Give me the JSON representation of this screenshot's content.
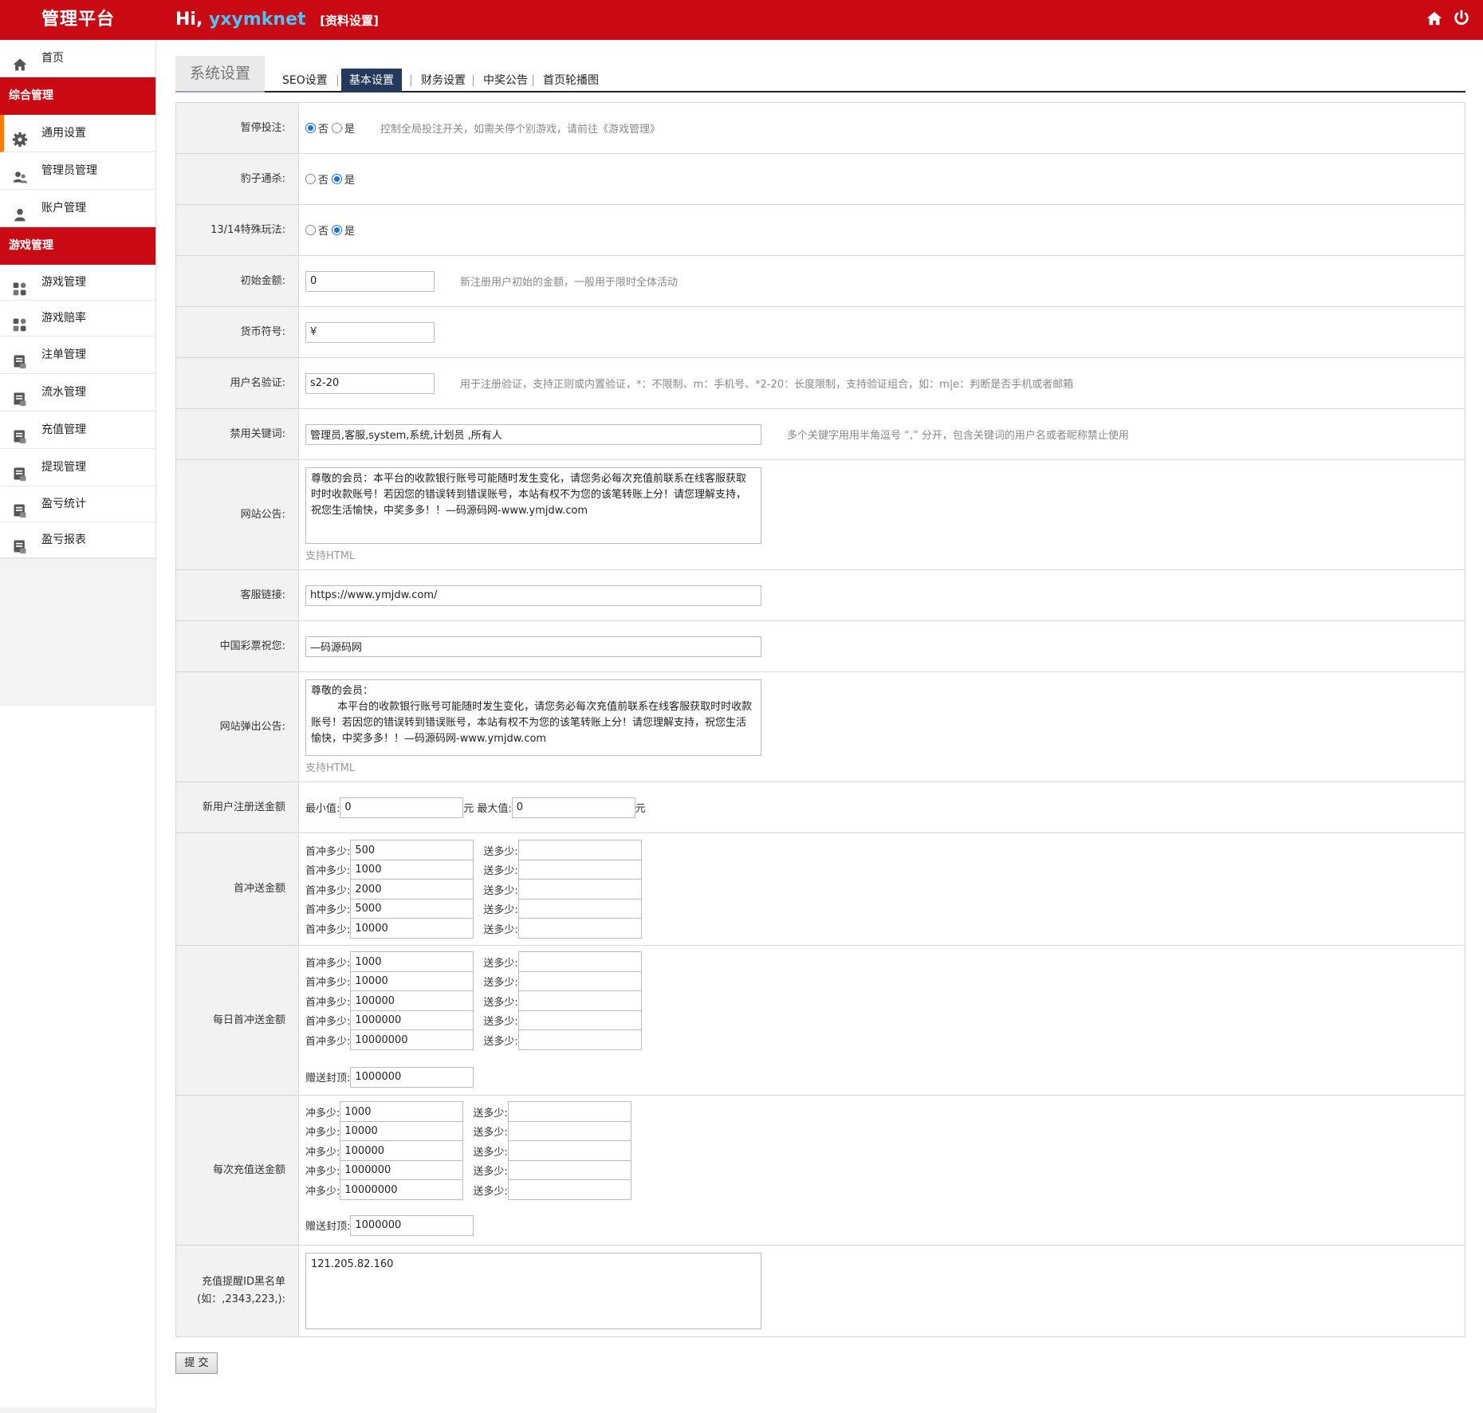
{
  "header": {
    "brand": "管理平台",
    "greeting": "Hi,",
    "username": "yxymknet",
    "profile_link": "[资料设置]"
  },
  "sidebar": {
    "home": "首页",
    "group1": "综合管理",
    "group1_items": [
      "通用设置",
      "管理员管理",
      "账户管理"
    ],
    "group2": "游戏管理",
    "group2_items": [
      "游戏管理",
      "游戏赔率",
      "注单管理",
      "流水管理",
      "充值管理",
      "提现管理",
      "盈亏统计",
      "盈亏报表"
    ]
  },
  "tabs": {
    "title": "系统设置",
    "items": [
      "SEO设置",
      "基本设置",
      "财务设置",
      "中奖公告",
      "首页轮播图"
    ],
    "active": "基本设置"
  },
  "form": {
    "pause_bet": {
      "label": "暂停投注:",
      "no": "否",
      "yes": "是",
      "selected": "否",
      "hint": "控制全局投注开关，如需关停个别游戏，请前往《游戏管理》"
    },
    "leopard": {
      "label": "豹子通杀:",
      "no": "否",
      "yes": "是",
      "selected": "是"
    },
    "special_1314": {
      "label": "13/14特殊玩法:",
      "no": "否",
      "yes": "是",
      "selected": "是"
    },
    "initial_amount": {
      "label": "初始金额:",
      "value": "0",
      "hint": "新注册用户初始的金额，一般用于限时全体活动"
    },
    "currency": {
      "label": "货币符号:",
      "value": "¥"
    },
    "username_check": {
      "label": "用户名验证:",
      "value": "s2-20",
      "hint": "用于注册验证，支持正则或内置验证，*：不限制、m：手机号、*2-20：长度限制，支持验证组合，如：m|e：判断是否手机或者邮箱"
    },
    "banned_words": {
      "label": "禁用关键词:",
      "value": "管理员,客服,system,系统,计划员 ,所有人",
      "hint": "多个关键字用用半角逗号 “,” 分开，包含关键词的用户名或者昵称禁止使用"
    },
    "site_notice": {
      "label": "网站公告:",
      "value": "尊敬的会员：本平台的收款银行账号可能随时发生变化，请您务必每次充值前联系在线客服获取时时收款账号！若因您的错误转到错误账号，本站有权不为您的该笔转账上分！请您理解支持，祝您生活愉快，中奖多多！！—码源码网-www.ymjdw.com",
      "note": "支持HTML"
    },
    "service_link": {
      "label": "客服链接:",
      "value": "https://www.ymjdw.com/"
    },
    "lottery_wish": {
      "label": "中国彩票祝您:",
      "value": "—码源码网"
    },
    "popup_notice": {
      "label": "网站弹出公告:",
      "value": "尊敬的会员：\n        本平台的收款银行账号可能随时发生变化，请您务必每次充值前联系在线客服获取时时收款账号！若因您的错误转到错误账号，本站有权不为您的该笔转账上分！请您理解支持，祝您生活愉快，中奖多多！！—码源码网-www.ymjdw.com",
      "note": "支持HTML"
    },
    "new_user_bonus": {
      "label": "新用户注册送金额",
      "min_label": "最小值:",
      "min": "0",
      "unit": "元",
      "max_label": "最大值:",
      "max": "0"
    },
    "first_deposit": {
      "label": "首冲送金额",
      "amount_label": "首冲多少:",
      "bonus_label": "送多少:",
      "amounts": [
        "500",
        "1000",
        "2000",
        "5000",
        "10000"
      ]
    },
    "daily_first": {
      "label": "每日首冲送金额",
      "amount_label": "首冲多少:",
      "bonus_label": "送多少:",
      "amounts": [
        "1000",
        "10000",
        "100000",
        "1000000",
        "10000000"
      ],
      "cap_label": "赠送封顶:",
      "cap": "1000000"
    },
    "each_deposit": {
      "label": "每次充值送金额",
      "amount_label": "冲多少:",
      "bonus_label": "送多少:",
      "amounts": [
        "1000",
        "10000",
        "100000",
        "1000000",
        "10000000"
      ],
      "cap_label": "赠送封顶:",
      "cap": "1000000"
    },
    "blacklist": {
      "label1": "充值提醒ID黑名单",
      "label2": "(如：,2343,223,):",
      "value": "121.205.82.160"
    },
    "submit": "提 交"
  },
  "colors": {
    "header_red": "#c90a14",
    "active_tab": "#233a5c",
    "active_marker": "#ff7a00"
  }
}
